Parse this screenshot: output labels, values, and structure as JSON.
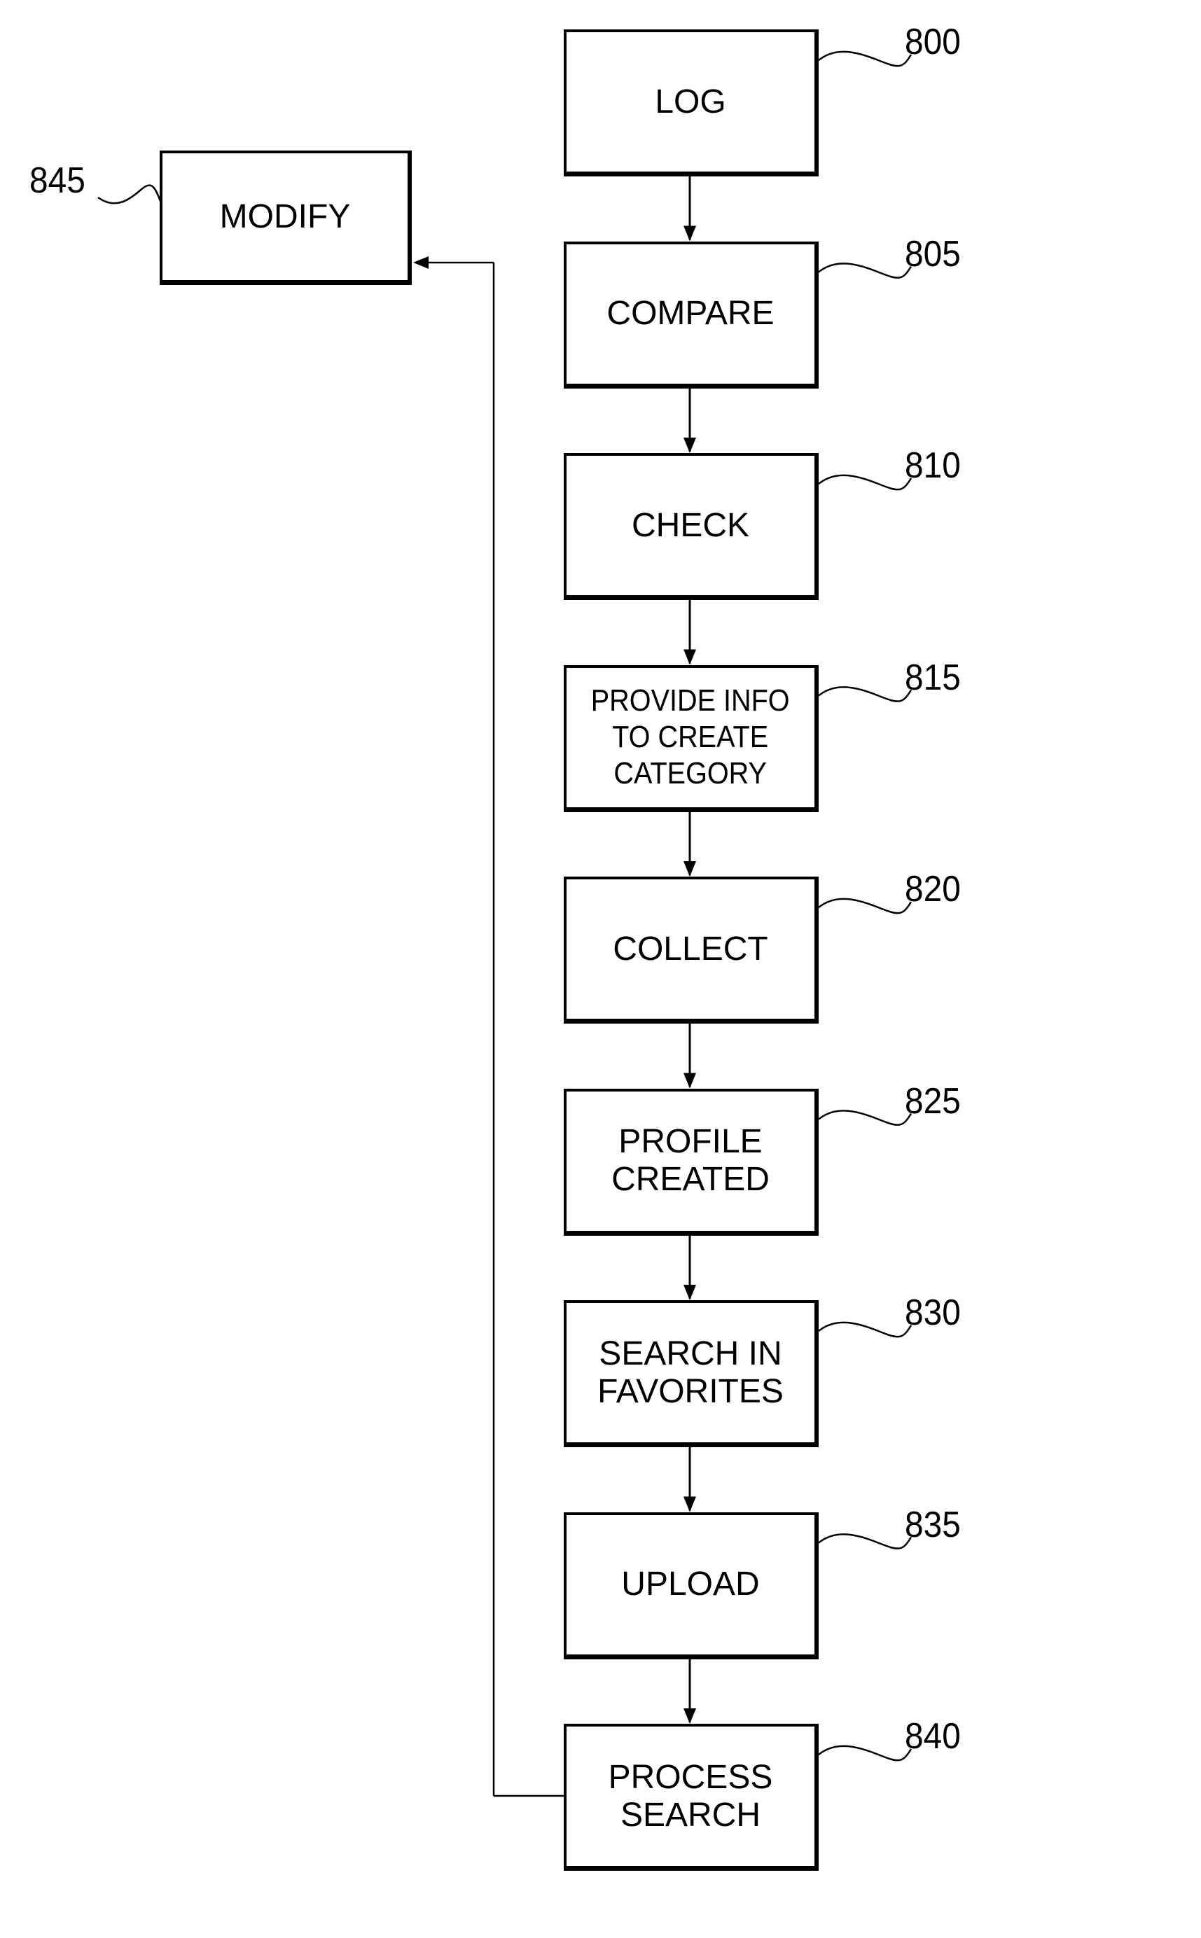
{
  "diagram": {
    "steps": [
      {
        "ref": "800",
        "label": "LOG"
      },
      {
        "ref": "805",
        "label": "COMPARE"
      },
      {
        "ref": "810",
        "label": "CHECK"
      },
      {
        "ref": "815",
        "label": "PROVIDE INFO\nTO CREATE\nCATEGORY"
      },
      {
        "ref": "820",
        "label": "COLLECT"
      },
      {
        "ref": "825",
        "label": "PROFILE\nCREATED"
      },
      {
        "ref": "830",
        "label": "SEARCH IN\nFAVORITES"
      },
      {
        "ref": "835",
        "label": "UPLOAD"
      },
      {
        "ref": "840",
        "label": "PROCESS\nSEARCH"
      }
    ],
    "side_step": {
      "ref": "845",
      "label": "MODIFY"
    },
    "edges": [
      {
        "from": "800",
        "to": "805"
      },
      {
        "from": "805",
        "to": "810"
      },
      {
        "from": "810",
        "to": "815"
      },
      {
        "from": "815",
        "to": "820"
      },
      {
        "from": "820",
        "to": "825"
      },
      {
        "from": "825",
        "to": "830"
      },
      {
        "from": "830",
        "to": "835"
      },
      {
        "from": "835",
        "to": "840"
      },
      {
        "from": "840",
        "to": "845"
      }
    ]
  }
}
